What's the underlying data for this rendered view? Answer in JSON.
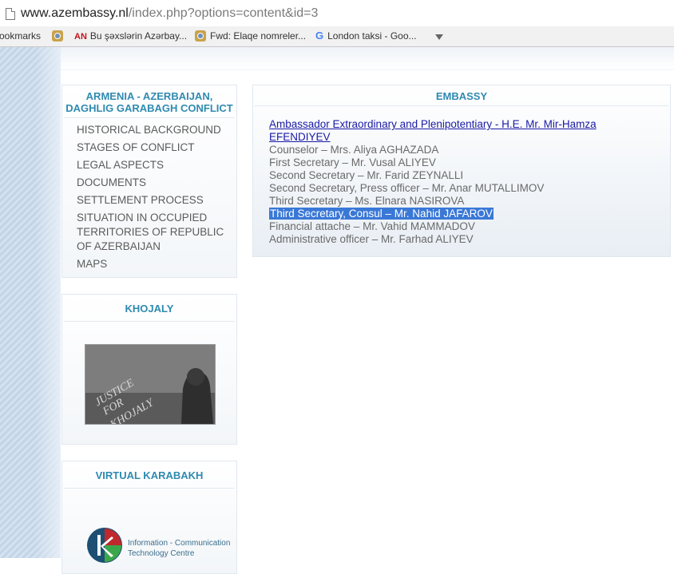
{
  "browser": {
    "url_host": "www.azembassy.nl",
    "url_path": "/index.php?options=content&id=3",
    "bookmarks": [
      {
        "label": "ookmarks",
        "icon": "none"
      },
      {
        "label": "",
        "icon": "ring-icon"
      },
      {
        "label": "Bu şəxslərin Azərbay...",
        "icon": "an-icon",
        "icon_text": "AN"
      },
      {
        "label": "Fwd: Elaqe nomreler...",
        "icon": "ring-icon"
      },
      {
        "label": "London taksi - Goo...",
        "icon": "google-icon",
        "icon_text": "G"
      },
      {
        "label": "",
        "icon": "download-icon"
      }
    ]
  },
  "sidebar": {
    "conflict": {
      "title": "ARMENIA - AZERBAIJAN, DAGHLIG GARABAGH CONFLICT",
      "items": [
        "HISTORICAL BACKGROUND",
        "STAGES OF CONFLICT",
        "LEGAL ASPECTS",
        "DOCUMENTS",
        "SETTLEMENT PROCESS",
        "SITUATION IN OCCUPIED TERRITORIES OF REPUBLIC OF AZERBAIJAN",
        "MAPS"
      ]
    },
    "khojaly": {
      "title": "KHOJALY",
      "image_text": "JUSTICE FOR KHOJALY"
    },
    "karabakh": {
      "title": "VIRTUAL KARABAKH",
      "logo_line1": "Information - Communication",
      "logo_line2": "Technology Centre"
    }
  },
  "main": {
    "title": "EMBASSY",
    "ambassador_link": "Ambassador Extraordinary and Plenipotentiary - H.E. Mr. Mir-Hamza EFENDIYEV",
    "staff": [
      "Counselor – Mrs. Aliya AGHAZADA",
      "First Secretary – Mr. Vusal ALIYEV",
      "Second Secretary – Mr. Farid ZEYNALLI",
      "Second Secretary, Press officer – Mr. Anar MUTALLIMOV",
      "Third Secretary – Ms. Elnara NASIROVA",
      "Third Secretary, Consul – Mr. Nahid JAFAROV",
      "Financial attache – Mr. Vahid MAMMADOV",
      "Administrative officer – Mr. Farhad ALIYEV"
    ],
    "highlighted_index": 5
  },
  "colors": {
    "title_blue": "#2f8ab0",
    "link_blue": "#1a1aa6",
    "selection": "#3a78d6"
  }
}
